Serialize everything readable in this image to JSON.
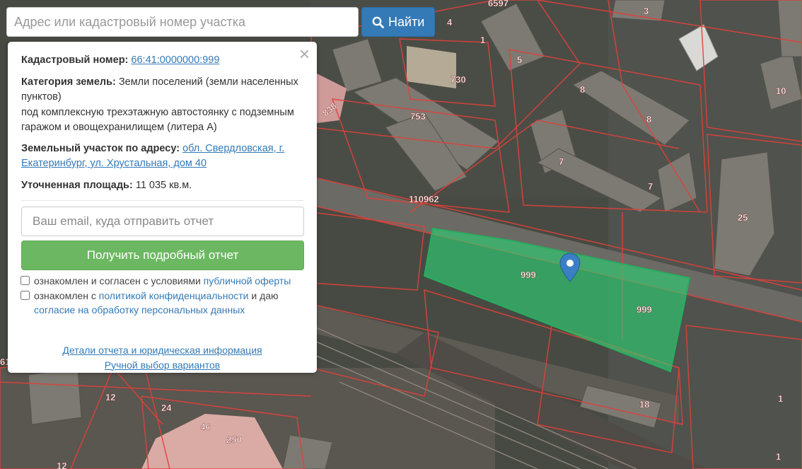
{
  "search": {
    "placeholder": "Адрес или кадастровый номер участка",
    "button_label": "Найти",
    "button_icon": "search-icon"
  },
  "info_panel": {
    "close_icon": "close-icon",
    "cadastral_label": "Кадастровый номер:",
    "cadastral_number": "66:41:0000000:999",
    "category_label": "Категория земель:",
    "category_value": "Земли поселений (земли населенных пунктов)",
    "purpose": "под комплексную трехэтажную автостоянку с подземным гаражом и овощехранилищем (литера А)",
    "address_label": "Земельный участок по адресу:",
    "address_link": "обл. Свердловская, г. Екатеринбург, ул. Хрустальная, дом 40",
    "area_label": "Уточненная площадь:",
    "area_value": "11 035 кв.м.",
    "email_placeholder": "Ваш email, куда отправить отчет",
    "report_button": "Получить подробный отчет",
    "consent1_text": "ознакомлен и согласен с условиями ",
    "consent1_link": "публичной оферты",
    "consent2_text_a": "ознакомлен с ",
    "consent2_link_a": "политикой конфиденциальности",
    "consent2_text_b": " и даю ",
    "consent2_link_b": "согласие на обработку персональных данных",
    "footer_link_1": "Детали отчета и юридическая информация",
    "footer_link_2": "Ручной выбор вариантов"
  },
  "map": {
    "highlight_color": "#2ecc71",
    "boundary_color": "#e0413a",
    "marker_color": "#3a7fc4",
    "labels": [
      "4",
      "1",
      "5",
      "730",
      "10",
      "753",
      "8",
      "8",
      "7",
      "7",
      "838",
      "110962",
      "25",
      "999",
      "999",
      "12",
      "24",
      "46",
      "250",
      "18",
      "1",
      "12",
      "1",
      "6597",
      "3",
      "61"
    ]
  }
}
